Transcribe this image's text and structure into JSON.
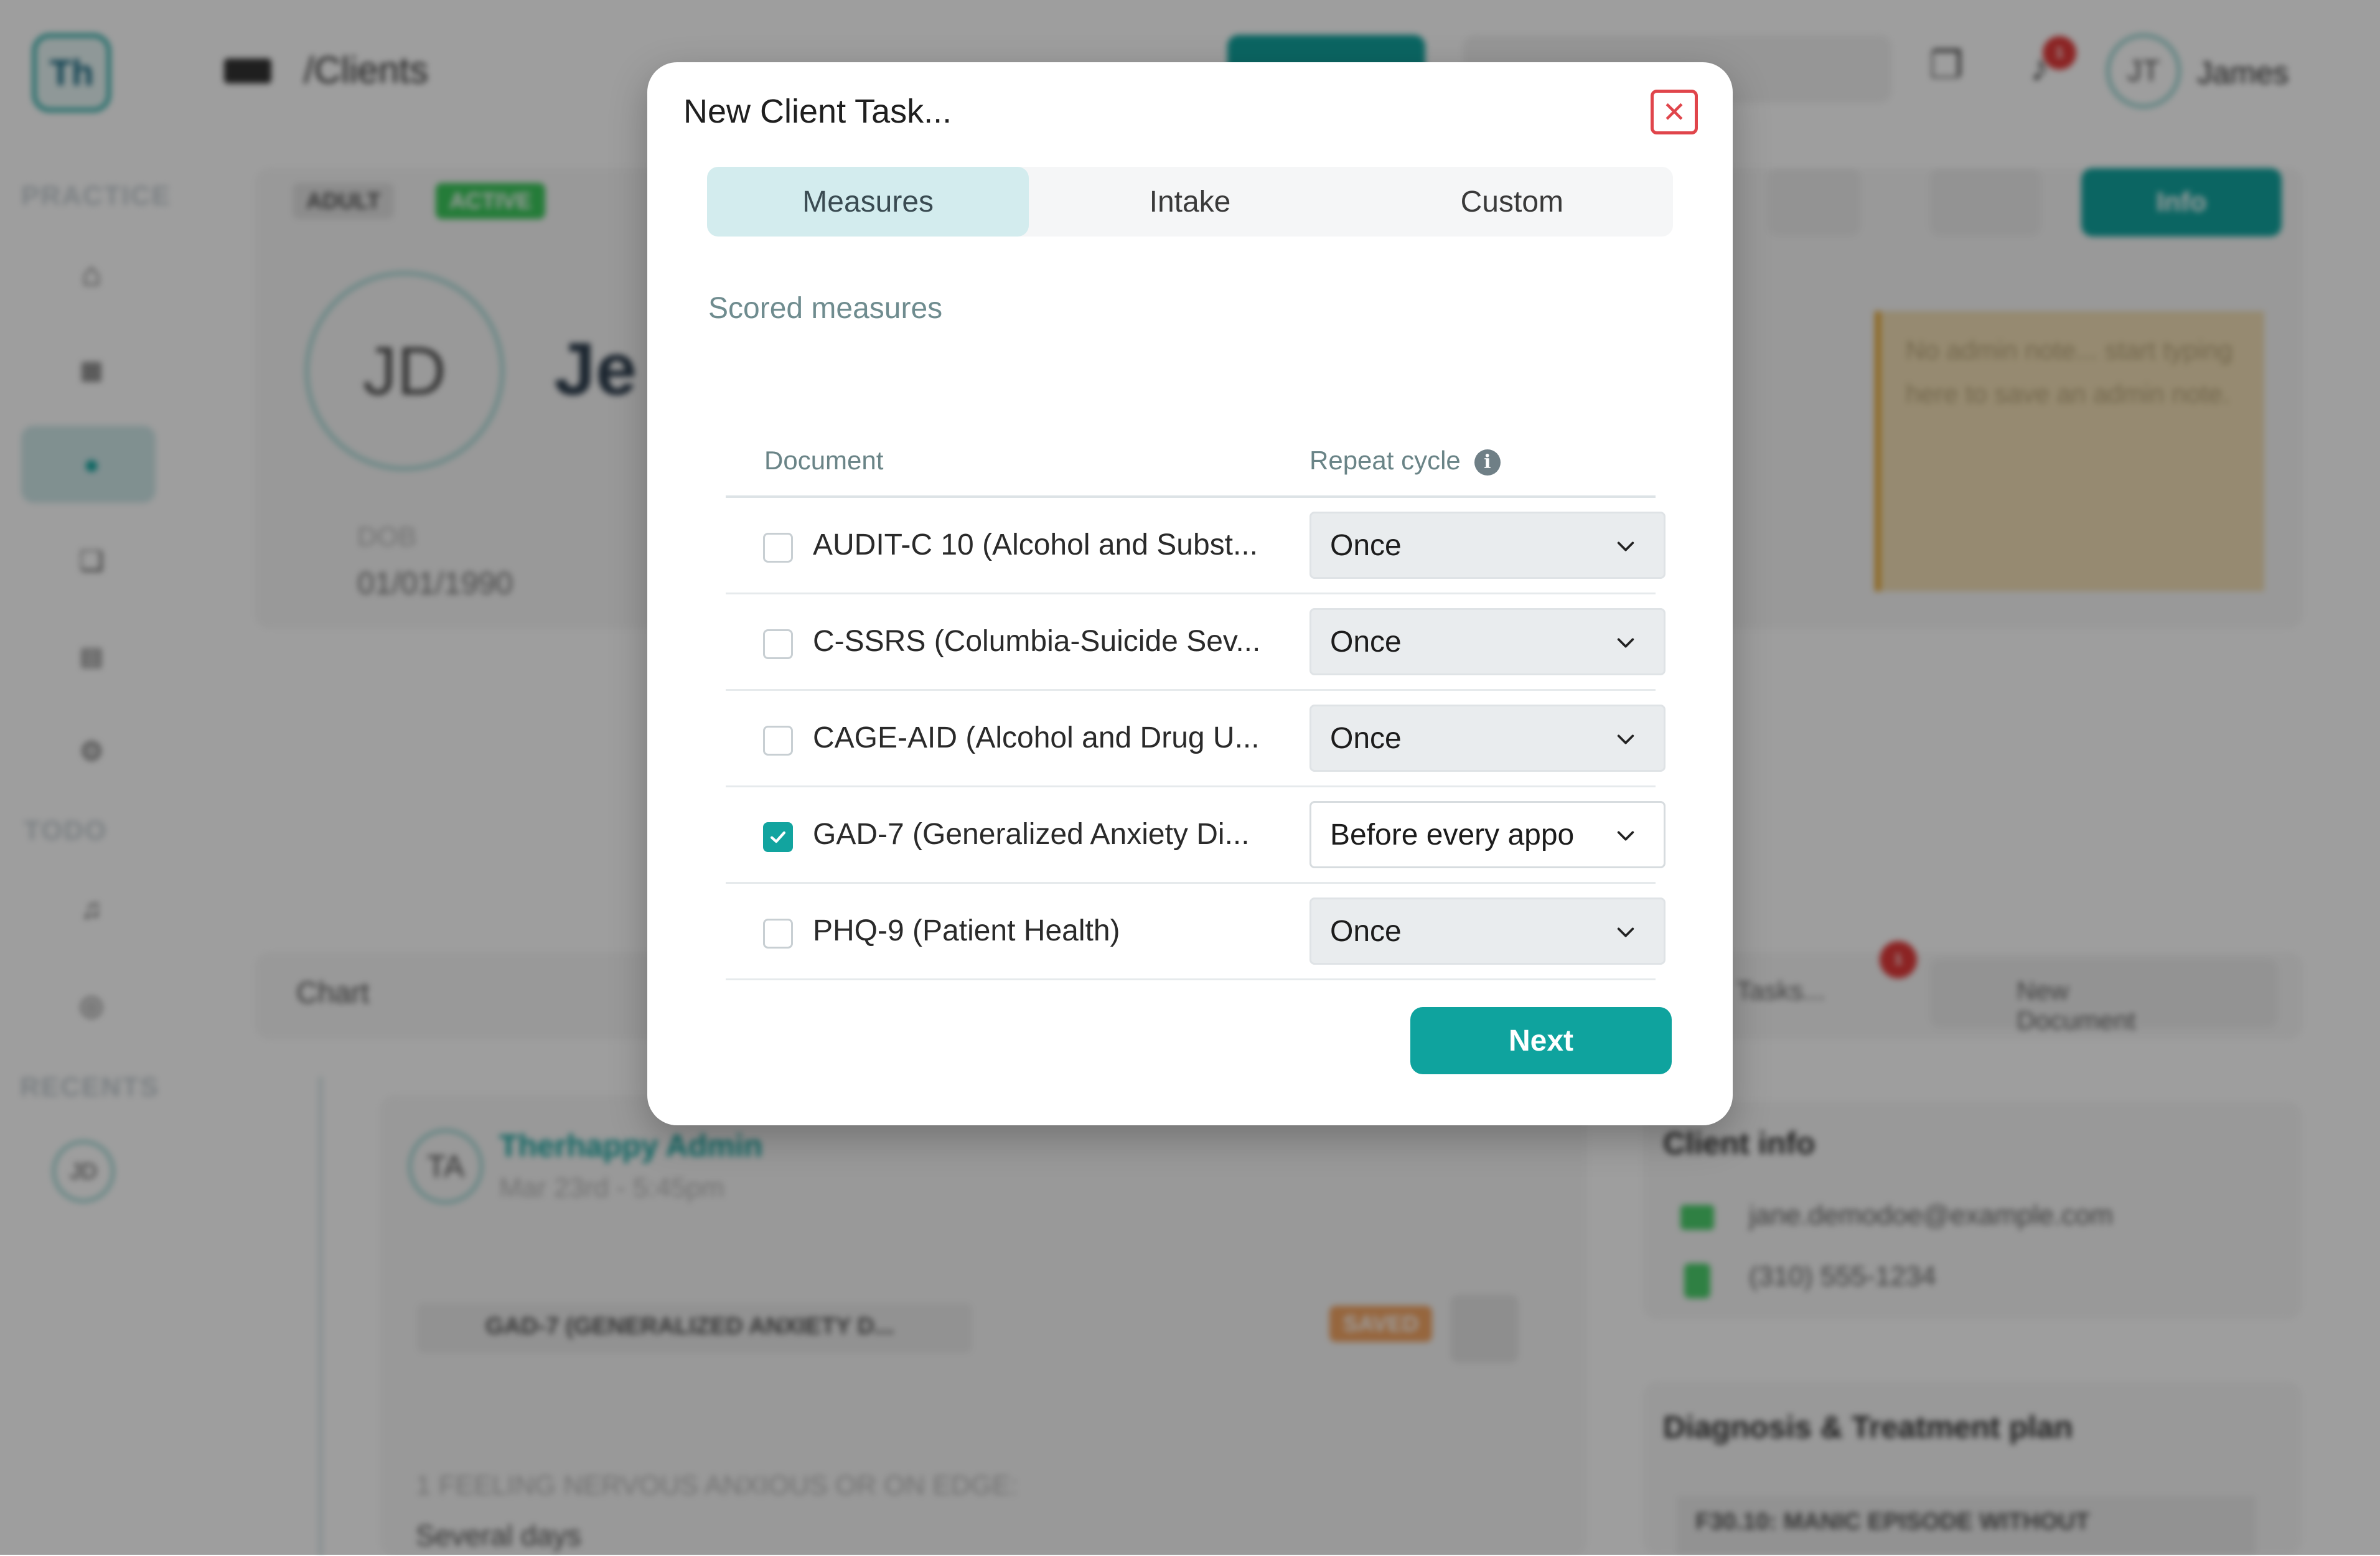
{
  "background": {
    "logo": "Th",
    "breadcrumb": "/Clients",
    "user_initials": "JT",
    "user_name": "James",
    "notification_count": "1",
    "nav_headings": [
      "PRACTICE",
      "TODO",
      "RECENTS"
    ],
    "recent_initials": "JD",
    "client_initials": "JD",
    "client_name_partial": "Je",
    "chip_adult": "ADULT",
    "chip_active": "ACTIVE",
    "dob_label": "DOB",
    "dob_value": "01/01/1990",
    "info_button": "Info",
    "admin_note": "No admin note... start typing here to save an admin note.",
    "chart_tab": "Chart",
    "tasks_dropdown": "Tasks...",
    "tasks_badge": "1",
    "new_document": "New Document",
    "entry_initials": "TA",
    "entry_author": "Therhappy Admin",
    "entry_time": "Mar 23rd - 5:45pm",
    "entry_doc": "GAD-7 (GENERALIZED ANXIETY D...",
    "entry_status": "SAVED",
    "entry_question": "1 FEELING NERVOUS ANXIOUS OR ON EDGE:",
    "entry_answer": "Several days",
    "client_info_title": "Client info",
    "client_email": "jane.demodoe@example.com",
    "client_phone": "(310) 555-1234",
    "diagnosis_title": "Diagnosis & Treatment plan",
    "diagnosis_item": "F30.10: MANIC EPISODE WITHOUT"
  },
  "modal": {
    "title": "New Client Task...",
    "tabs": [
      {
        "label": "Measures",
        "active": true
      },
      {
        "label": "Intake",
        "active": false
      },
      {
        "label": "Custom",
        "active": false
      }
    ],
    "section_label": "Scored measures",
    "columns": {
      "document": "Document",
      "repeat_cycle": "Repeat cycle"
    },
    "rows": [
      {
        "name": "AUDIT-C 10 (Alcohol and Subst...",
        "checked": false,
        "cycle": "Once"
      },
      {
        "name": "C-SSRS (Columbia-Suicide Sev...",
        "checked": false,
        "cycle": "Once"
      },
      {
        "name": "CAGE-AID (Alcohol and Drug U...",
        "checked": false,
        "cycle": "Once"
      },
      {
        "name": "GAD-7 (Generalized Anxiety Di...",
        "checked": true,
        "cycle": "Before every appo"
      },
      {
        "name": "PHQ-9 (Patient Health)",
        "checked": false,
        "cycle": "Once"
      }
    ],
    "next_label": "Next"
  }
}
